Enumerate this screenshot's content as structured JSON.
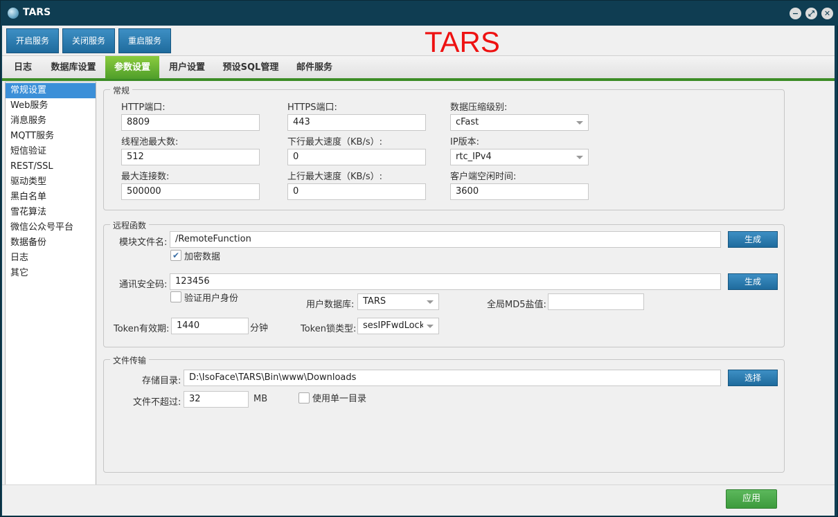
{
  "window": {
    "title": "TARS"
  },
  "toolbar": {
    "start_label": "开启服务",
    "stop_label": "关闭服务",
    "restart_label": "重启服务",
    "brand": "TARS"
  },
  "tabs": [
    {
      "label": "日志"
    },
    {
      "label": "数据库设置"
    },
    {
      "label": "参数设置"
    },
    {
      "label": "用户设置"
    },
    {
      "label": "预设SQL管理"
    },
    {
      "label": "邮件服务"
    }
  ],
  "active_tab": "参数设置",
  "sidebar": {
    "items": [
      {
        "label": "常规设置"
      },
      {
        "label": "Web服务"
      },
      {
        "label": "消息服务"
      },
      {
        "label": "MQTT服务"
      },
      {
        "label": "短信验证"
      },
      {
        "label": "REST/SSL"
      },
      {
        "label": "驱动类型"
      },
      {
        "label": "黑白名单"
      },
      {
        "label": "雪花算法"
      },
      {
        "label": "微信公众号平台"
      },
      {
        "label": "数据备份"
      },
      {
        "label": "日志"
      },
      {
        "label": "其它"
      }
    ],
    "active": "常规设置"
  },
  "general": {
    "legend": "常规",
    "http_port_label": "HTTP端口:",
    "http_port": "8809",
    "https_port_label": "HTTPS端口:",
    "https_port": "443",
    "compression_label": "数据压缩级别:",
    "compression": "cFast",
    "threadpool_label": "线程池最大数:",
    "threadpool": "512",
    "download_speed_label": "下行最大速度（KB/s）:",
    "download_speed": "0",
    "ip_version_label": "IP版本:",
    "ip_version": "rtc_IPv4",
    "max_conn_label": "最大连接数:",
    "max_conn": "500000",
    "upload_speed_label": "上行最大速度（KB/s）:",
    "upload_speed": "0",
    "idle_time_label": "客户端空闲时间:",
    "idle_time": "3600"
  },
  "remote": {
    "legend": "远程函数",
    "module_label": "模块文件名:",
    "module_value": "/RemoteFunction",
    "generate_label": "生成",
    "encrypt_label": "加密数据",
    "encrypt_checked": true,
    "secret_label": "通讯安全码:",
    "secret_value": "123456",
    "generate2_label": "生成",
    "verify_label": "验证用户身份",
    "verify_checked": false,
    "userdb_label": "用户数据库:",
    "userdb_value": "TARS",
    "md5_label": "全局MD5盐值:",
    "md5_value": "",
    "token_label": "Token有效期:",
    "token_value": "1440",
    "token_unit": "分钟",
    "locktype_label": "Token锁类型:",
    "locktype_value": "sesIPFwdLock"
  },
  "transfer": {
    "legend": "文件传输",
    "dir_label": "存储目录:",
    "dir_value": "D:\\IsoFace\\TARS\\Bin\\www\\Downloads",
    "choose_label": "选择",
    "limit_label": "文件不超过:",
    "limit_value": "32",
    "limit_unit": "MB",
    "single_dir_label": "使用单一目录",
    "single_dir_checked": false
  },
  "footer": {
    "apply_label": "应用"
  },
  "colors": {
    "accent_green": "#3c8c26",
    "button_blue": "#1f6b9d",
    "brand_red": "#ee1111"
  }
}
